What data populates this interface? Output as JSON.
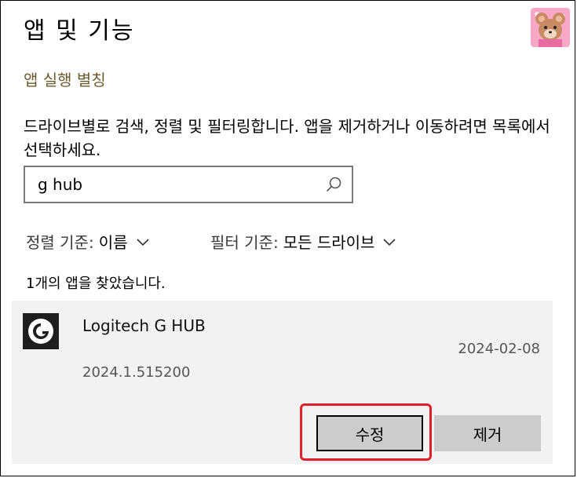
{
  "header": {
    "title": "앱 및 기능",
    "avatar_icon": "bear-avatar-icon"
  },
  "section": {
    "title": "앱 실행 별칭",
    "description": "드라이브별로 검색, 정렬 및 필터링합니다. 앱을 제거하거나 이동하려면 목록에서 선택하세요."
  },
  "search": {
    "value": "g hub",
    "icon": "search-icon"
  },
  "sort": {
    "label": "정렬 기준:",
    "value": "이름"
  },
  "filter": {
    "label": "필터 기준:",
    "value": "모든 드라이브"
  },
  "results": {
    "count_text": "1개의 앱을 찾았습니다."
  },
  "app": {
    "name": "Logitech G HUB",
    "date": "2024-02-08",
    "version": "2024.1.515200",
    "icon": "logitech-g-icon",
    "modify_label": "수정",
    "uninstall_label": "제거"
  },
  "colors": {
    "accent_text": "#6b5a2e",
    "highlight": "#e01f2a",
    "card_bg": "#f2f2f2",
    "button_bg": "#cccccc"
  }
}
